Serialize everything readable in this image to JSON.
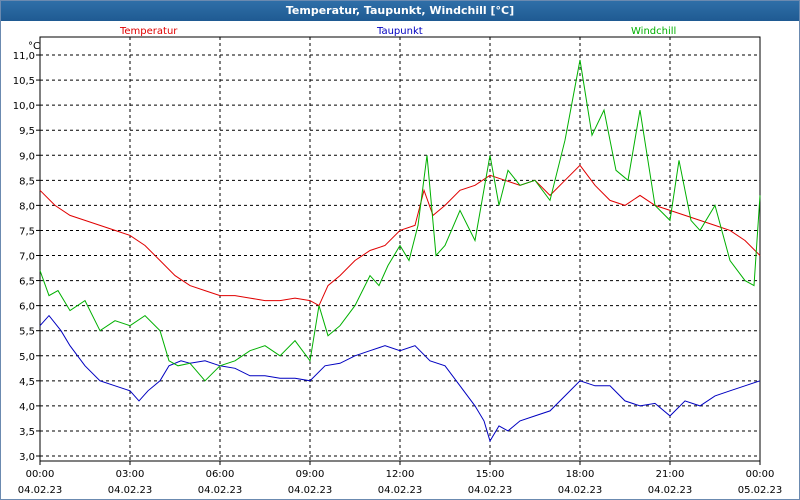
{
  "window": {
    "title": "Temperatur, Taupunkt, Windchill [°C]"
  },
  "chart_data": {
    "type": "line",
    "title": "Temperatur, Taupunkt, Windchill [°C]",
    "ylabel": "°C",
    "ylim": [
      3.0,
      11.0
    ],
    "yticks": [
      "3,0",
      "3,5",
      "4,0",
      "4,5",
      "5,0",
      "5,5",
      "6,0",
      "6,5",
      "7,0",
      "7,5",
      "8,0",
      "8,5",
      "9,0",
      "9,5",
      "10,0",
      "10,5",
      "11,0"
    ],
    "xlim": [
      0,
      24
    ],
    "xticks": [
      {
        "t": 0,
        "time": "00:00",
        "date": "04.02.23"
      },
      {
        "t": 3,
        "time": "03:00",
        "date": "04.02.23"
      },
      {
        "t": 6,
        "time": "06:00",
        "date": "04.02.23"
      },
      {
        "t": 9,
        "time": "09:00",
        "date": "04.02.23"
      },
      {
        "t": 12,
        "time": "12:00",
        "date": "04.02.23"
      },
      {
        "t": 15,
        "time": "15:00",
        "date": "04.02.23"
      },
      {
        "t": 18,
        "time": "18:00",
        "date": "04.02.23"
      },
      {
        "t": 21,
        "time": "21:00",
        "date": "04.02.23"
      },
      {
        "t": 24,
        "time": "00:00",
        "date": "05.02.23"
      }
    ],
    "grid": true,
    "series": [
      {
        "name": "Temperatur",
        "color": "#e00000",
        "points": [
          [
            0,
            8.3
          ],
          [
            0.5,
            8.0
          ],
          [
            1,
            7.8
          ],
          [
            1.5,
            7.7
          ],
          [
            2,
            7.6
          ],
          [
            2.5,
            7.5
          ],
          [
            3,
            7.4
          ],
          [
            3.5,
            7.2
          ],
          [
            4,
            6.9
          ],
          [
            4.5,
            6.6
          ],
          [
            5,
            6.4
          ],
          [
            5.5,
            6.3
          ],
          [
            6,
            6.2
          ],
          [
            6.5,
            6.2
          ],
          [
            7,
            6.15
          ],
          [
            7.5,
            6.1
          ],
          [
            8,
            6.1
          ],
          [
            8.5,
            6.15
          ],
          [
            9,
            6.1
          ],
          [
            9.3,
            6.0
          ],
          [
            9.6,
            6.4
          ],
          [
            10,
            6.6
          ],
          [
            10.5,
            6.9
          ],
          [
            11,
            7.1
          ],
          [
            11.5,
            7.2
          ],
          [
            12,
            7.5
          ],
          [
            12.5,
            7.6
          ],
          [
            12.8,
            8.3
          ],
          [
            13.1,
            7.8
          ],
          [
            13.5,
            8.0
          ],
          [
            14,
            8.3
          ],
          [
            14.5,
            8.4
          ],
          [
            15,
            8.6
          ],
          [
            15.5,
            8.5
          ],
          [
            16,
            8.4
          ],
          [
            16.5,
            8.5
          ],
          [
            17,
            8.2
          ],
          [
            17.5,
            8.5
          ],
          [
            18,
            8.8
          ],
          [
            18.5,
            8.4
          ],
          [
            19,
            8.1
          ],
          [
            19.5,
            8.0
          ],
          [
            20,
            8.2
          ],
          [
            20.5,
            8.0
          ],
          [
            21,
            7.9
          ],
          [
            21.5,
            7.8
          ],
          [
            22,
            7.7
          ],
          [
            22.5,
            7.6
          ],
          [
            23,
            7.5
          ],
          [
            23.5,
            7.3
          ],
          [
            24,
            7.0
          ]
        ]
      },
      {
        "name": "Taupunkt",
        "color": "#0000c0",
        "points": [
          [
            0,
            5.6
          ],
          [
            0.3,
            5.8
          ],
          [
            0.7,
            5.5
          ],
          [
            1,
            5.2
          ],
          [
            1.5,
            4.8
          ],
          [
            2,
            4.5
          ],
          [
            2.5,
            4.4
          ],
          [
            3,
            4.3
          ],
          [
            3.3,
            4.1
          ],
          [
            3.6,
            4.3
          ],
          [
            4,
            4.5
          ],
          [
            4.3,
            4.8
          ],
          [
            4.7,
            4.9
          ],
          [
            5,
            4.85
          ],
          [
            5.5,
            4.9
          ],
          [
            6,
            4.8
          ],
          [
            6.5,
            4.75
          ],
          [
            7,
            4.6
          ],
          [
            7.5,
            4.6
          ],
          [
            8,
            4.55
          ],
          [
            8.5,
            4.55
          ],
          [
            9,
            4.5
          ],
          [
            9.5,
            4.8
          ],
          [
            10,
            4.85
          ],
          [
            10.5,
            5.0
          ],
          [
            11,
            5.1
          ],
          [
            11.5,
            5.2
          ],
          [
            12,
            5.1
          ],
          [
            12.5,
            5.2
          ],
          [
            13,
            4.9
          ],
          [
            13.5,
            4.8
          ],
          [
            14,
            4.4
          ],
          [
            14.5,
            4.0
          ],
          [
            14.8,
            3.7
          ],
          [
            15,
            3.3
          ],
          [
            15.3,
            3.6
          ],
          [
            15.6,
            3.5
          ],
          [
            16,
            3.7
          ],
          [
            16.5,
            3.8
          ],
          [
            17,
            3.9
          ],
          [
            17.5,
            4.2
          ],
          [
            18,
            4.5
          ],
          [
            18.5,
            4.4
          ],
          [
            19,
            4.4
          ],
          [
            19.5,
            4.1
          ],
          [
            20,
            4.0
          ],
          [
            20.5,
            4.05
          ],
          [
            21,
            3.8
          ],
          [
            21.5,
            4.1
          ],
          [
            22,
            4.0
          ],
          [
            22.5,
            4.2
          ],
          [
            23,
            4.3
          ],
          [
            23.5,
            4.4
          ],
          [
            24,
            4.5
          ]
        ]
      },
      {
        "name": "Windchill",
        "color": "#00b000",
        "points": [
          [
            0,
            6.7
          ],
          [
            0.3,
            6.2
          ],
          [
            0.6,
            6.3
          ],
          [
            1,
            5.9
          ],
          [
            1.5,
            6.1
          ],
          [
            2,
            5.5
          ],
          [
            2.5,
            5.7
          ],
          [
            3,
            5.6
          ],
          [
            3.5,
            5.8
          ],
          [
            4,
            5.5
          ],
          [
            4.3,
            4.9
          ],
          [
            4.6,
            4.8
          ],
          [
            5,
            4.85
          ],
          [
            5.5,
            4.5
          ],
          [
            6,
            4.8
          ],
          [
            6.5,
            4.9
          ],
          [
            7,
            5.1
          ],
          [
            7.5,
            5.2
          ],
          [
            8,
            5.0
          ],
          [
            8.5,
            5.3
          ],
          [
            9,
            4.9
          ],
          [
            9.3,
            6.0
          ],
          [
            9.6,
            5.4
          ],
          [
            10,
            5.6
          ],
          [
            10.5,
            6.0
          ],
          [
            11,
            6.6
          ],
          [
            11.3,
            6.4
          ],
          [
            11.6,
            6.8
          ],
          [
            12,
            7.2
          ],
          [
            12.3,
            6.9
          ],
          [
            12.6,
            7.6
          ],
          [
            12.9,
            9.0
          ],
          [
            13.2,
            7.0
          ],
          [
            13.5,
            7.2
          ],
          [
            14,
            7.9
          ],
          [
            14.5,
            7.3
          ],
          [
            15,
            9.0
          ],
          [
            15.3,
            8.0
          ],
          [
            15.6,
            8.7
          ],
          [
            16,
            8.4
          ],
          [
            16.5,
            8.5
          ],
          [
            17,
            8.1
          ],
          [
            17.5,
            9.3
          ],
          [
            18,
            10.9
          ],
          [
            18.4,
            9.4
          ],
          [
            18.8,
            9.9
          ],
          [
            19.2,
            8.7
          ],
          [
            19.6,
            8.5
          ],
          [
            20,
            9.9
          ],
          [
            20.5,
            8.0
          ],
          [
            21,
            7.7
          ],
          [
            21.3,
            8.9
          ],
          [
            21.7,
            7.7
          ],
          [
            22,
            7.5
          ],
          [
            22.5,
            8.0
          ],
          [
            23,
            6.9
          ],
          [
            23.5,
            6.5
          ],
          [
            23.8,
            6.4
          ],
          [
            24,
            8.2
          ]
        ]
      }
    ]
  }
}
